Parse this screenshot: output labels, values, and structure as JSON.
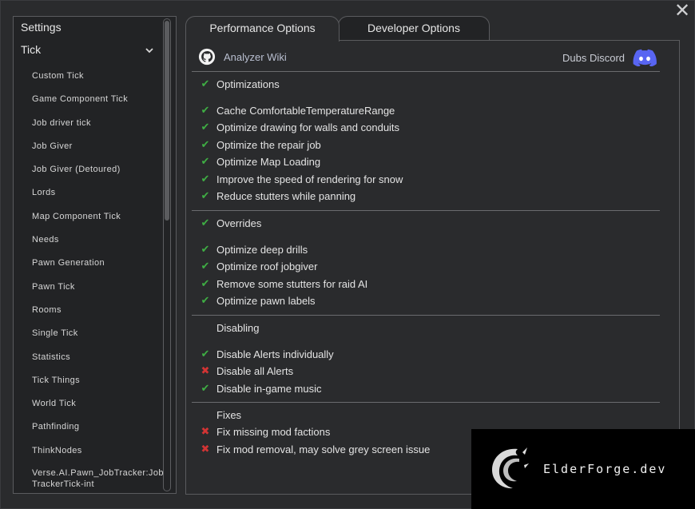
{
  "sidebar": {
    "header": "Settings",
    "section": "Tick",
    "items": [
      "Custom Tick",
      "Game Component Tick",
      "Job driver tick",
      "Job Giver",
      "Job Giver (Detoured)",
      "Lords",
      "Map Component Tick",
      "Needs",
      "Pawn Generation",
      "Pawn Tick",
      "Rooms",
      "Single Tick",
      "Statistics",
      "Tick Things",
      "World Tick",
      "Pathfinding",
      "ThinkNodes",
      "Verse.AI.Pawn_JobTracker:JobTrackerTick-int"
    ]
  },
  "tabs": [
    "Performance Options",
    "Developer Options"
  ],
  "links": {
    "wiki": "Analyzer Wiki",
    "discord": "Dubs Discord"
  },
  "sections": [
    {
      "title": "Optimizations",
      "enabled": true,
      "items": [
        {
          "label": "Cache ComfortableTemperatureRange",
          "state": "check"
        },
        {
          "label": "Optimize drawing for walls and conduits",
          "state": "check"
        },
        {
          "label": "Optimize the repair job",
          "state": "check"
        },
        {
          "label": "Optimize Map Loading",
          "state": "check"
        },
        {
          "label": "Improve the speed of rendering for snow",
          "state": "check"
        },
        {
          "label": "Reduce stutters while panning",
          "state": "check"
        }
      ]
    },
    {
      "title": "Overrides",
      "enabled": true,
      "items": [
        {
          "label": "Optimize deep drills",
          "state": "check"
        },
        {
          "label": "Optimize roof jobgiver",
          "state": "check"
        },
        {
          "label": "Remove some stutters for raid AI",
          "state": "check"
        },
        {
          "label": "Optimize pawn labels",
          "state": "check"
        }
      ]
    },
    {
      "title": "Disabling",
      "enabled": false,
      "items": [
        {
          "label": "Disable Alerts individually",
          "state": "check"
        },
        {
          "label": "Disable all Alerts",
          "state": "cross"
        },
        {
          "label": "Disable in-game music",
          "state": "check"
        }
      ]
    },
    {
      "title": "Fixes",
      "enabled": false,
      "items": [
        {
          "label": "Fix missing mod factions",
          "state": "cross"
        },
        {
          "label": "Fix mod removal, may solve grey screen issue",
          "state": "cross"
        }
      ]
    }
  ],
  "watermark": "ElderForge.dev",
  "colors": {
    "check": "#3fae44",
    "cross": "#d23434",
    "accent": "#5865f2"
  }
}
